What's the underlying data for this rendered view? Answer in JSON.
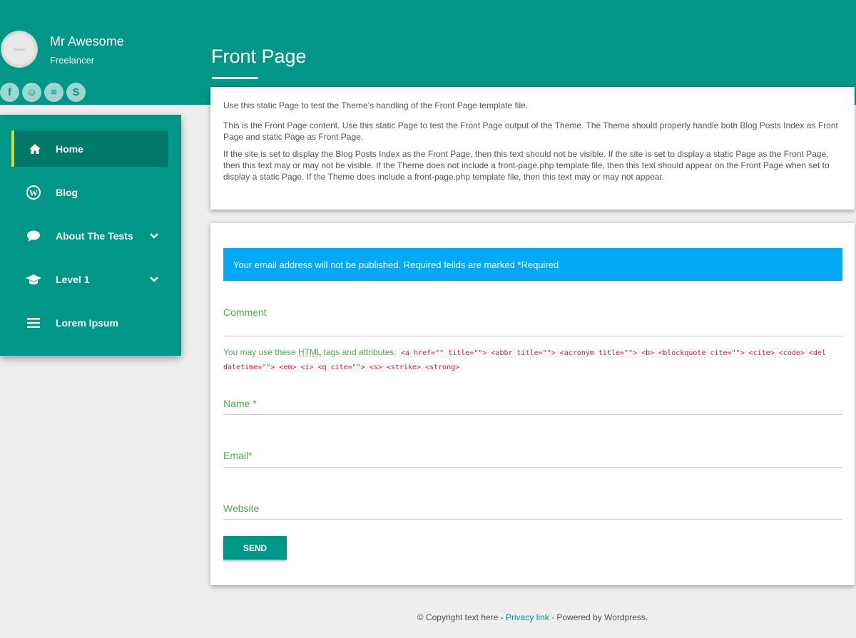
{
  "profile": {
    "name": "Mr Awesome",
    "role": "Freelancer"
  },
  "social": [
    {
      "icon": "facebook-icon",
      "glyph": "f"
    },
    {
      "icon": "github-icon",
      "glyph": "☺"
    },
    {
      "icon": "stackoverflow-icon",
      "glyph": "≡"
    },
    {
      "icon": "skype-icon",
      "glyph": "S"
    }
  ],
  "page": {
    "title": "Front Page"
  },
  "nav": {
    "items": [
      {
        "label": "Home",
        "icon": "home-icon",
        "glyph": "⌂"
      },
      {
        "label": "Blog",
        "icon": "wordpress-icon",
        "glyph": "W"
      },
      {
        "label": "About The Tests",
        "icon": "comment-icon",
        "glyph": "●"
      },
      {
        "label": "Level 1",
        "icon": "graduation-cap-icon",
        "glyph": "▲"
      },
      {
        "label": "Lorem Ipsum",
        "icon": "menu-icon",
        "glyph": "☰"
      }
    ],
    "chevron": "⌄"
  },
  "content": {
    "p1": "Use this static Page to test the Theme’s handling of the Front Page template file.",
    "p2": "This is the Front Page content. Use this static Page to test the Front Page output of the Theme. The Theme should properly handle both Blog Posts Index as Front Page and static Page as Front Page.",
    "p3": "If the site is set to display the Blog Posts Index as the Front Page, then this text should not be visible. If the site is set to display a static Page as the Front Page, then this text may or may not be visible. If the Theme does not include a front-page.php template file, then this text should appear on the Front Page when set to display a static Page. If the Theme does include a front-page.php template file, then this text may or may not appear."
  },
  "form": {
    "notice": "Your email address will not be published. Required feilds are marked *Required",
    "comment_label": "Comment",
    "allowed_prefix": "You may use these",
    "allowed_abbr": "HTML",
    "allowed_suffix": "tags and attributes:",
    "allowed_code": "<a href=\"\" title=\"\"> <abbr title=\"\"> <acronym title=\"\"> <b> <blockquote cite=\"\"> <cite> <code> <del datetime=\"\"> <em> <i> <q cite=\"\"> <s> <strike> <strong>",
    "name_label": "Name *",
    "email_label": "Email*",
    "website_label": "Website",
    "send_label": "SEND"
  },
  "footer": {
    "copyright": "© Copyright text here - ",
    "privacy": "Privacy link",
    "powered": " - Powered by Wordpress."
  }
}
